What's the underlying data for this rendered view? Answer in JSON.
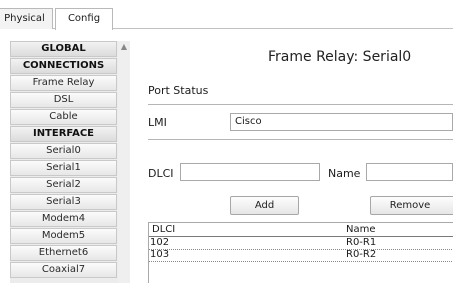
{
  "tabs": [
    "Physical",
    "Config"
  ],
  "sidebar": {
    "items": [
      {
        "label": "GLOBAL",
        "header": true
      },
      {
        "label": "CONNECTIONS",
        "header": true
      },
      {
        "label": "Frame Relay",
        "header": false
      },
      {
        "label": "DSL",
        "header": false
      },
      {
        "label": "Cable",
        "header": false
      },
      {
        "label": "INTERFACE",
        "header": true
      },
      {
        "label": "Serial0",
        "header": false
      },
      {
        "label": "Serial1",
        "header": false
      },
      {
        "label": "Serial2",
        "header": false
      },
      {
        "label": "Serial3",
        "header": false
      },
      {
        "label": "Modem4",
        "header": false
      },
      {
        "label": "Modem5",
        "header": false
      },
      {
        "label": "Ethernet6",
        "header": false
      },
      {
        "label": "Coaxial7",
        "header": false
      }
    ]
  },
  "main": {
    "title": "Frame Relay: Serial0",
    "port_status_label": "Port Status",
    "lmi_label": "LMI",
    "lmi_value": "Cisco",
    "dlci_label": "DLCI",
    "dlci_value": "",
    "name_label": "Name",
    "name_value": "",
    "add_label": "Add",
    "remove_label": "Remove",
    "table": {
      "headers": [
        "DLCI",
        "Name"
      ],
      "rows": [
        [
          "102",
          "R0-R1"
        ],
        [
          "103",
          "R0-R2"
        ]
      ]
    }
  },
  "colors": {
    "background": "#ffffff",
    "sidebar_bg": "#ececec",
    "border": "#a9a9a9"
  }
}
